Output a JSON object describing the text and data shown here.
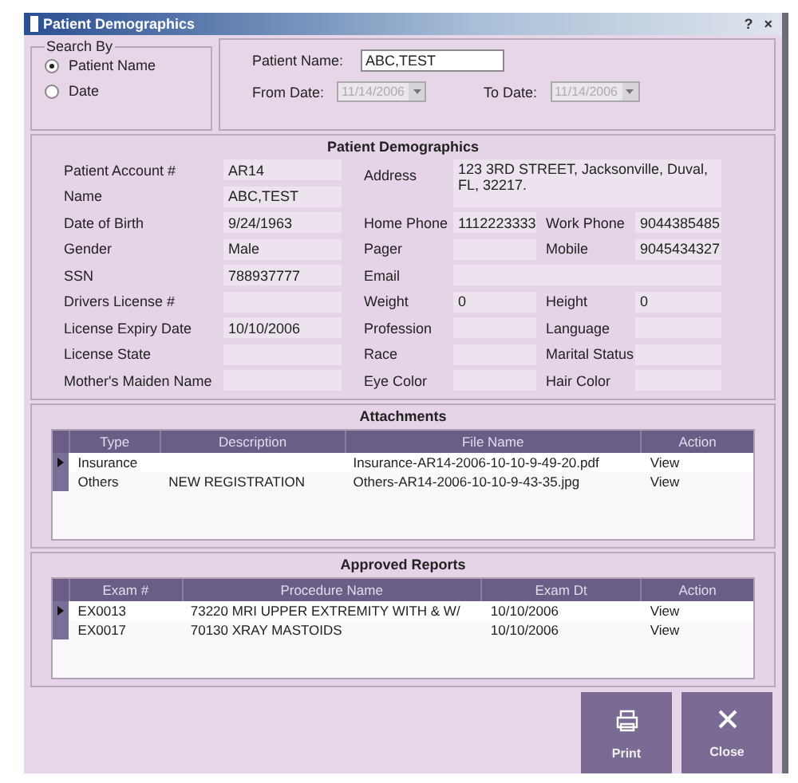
{
  "window": {
    "title": "Patient Demographics",
    "help_button": "?",
    "close_button": "×"
  },
  "search": {
    "group_label": "Search By",
    "options": [
      {
        "label": "Patient Name",
        "selected": true
      },
      {
        "label": "Date",
        "selected": false
      }
    ],
    "patient_name": {
      "label": "Patient Name:",
      "value": "ABC,TEST"
    },
    "from_date": {
      "label": "From Date:",
      "value": "11/14/2006",
      "disabled": true
    },
    "to_date": {
      "label": "To Date:",
      "value": "11/14/2006",
      "disabled": true
    }
  },
  "demographics": {
    "title": "Patient Demographics",
    "left_fields": [
      {
        "label": "Patient Account #",
        "value": "AR14"
      },
      {
        "label": "Name",
        "value": "ABC,TEST"
      },
      {
        "label": "Date of Birth",
        "value": "9/24/1963"
      },
      {
        "label": "Gender",
        "value": "Male"
      },
      {
        "label": "SSN",
        "value": "788937777"
      },
      {
        "label": "Drivers License #"
      },
      {
        "label": "License Expiry Date",
        "value": "10/10/2006"
      },
      {
        "label": "License State"
      },
      {
        "label": "Mother's Maiden Name"
      }
    ],
    "right_rows": [
      {
        "kind": "tall",
        "fields": [
          {
            "label": "Address",
            "value": "123 3RD STREET, Jacksonville, Duval, FL, 32217."
          }
        ]
      },
      {
        "kind": "pair",
        "fields": [
          {
            "label": "Home Phone",
            "value": "1112223333"
          },
          {
            "label": "Work Phone",
            "value": "9044385485"
          }
        ]
      },
      {
        "kind": "pair",
        "fields": [
          {
            "label": "Pager"
          },
          {
            "label": "Mobile",
            "value": "9045434327"
          }
        ]
      },
      {
        "kind": "wide",
        "fields": [
          {
            "label": "Email"
          }
        ]
      },
      {
        "kind": "pair",
        "fields": [
          {
            "label": "Weight",
            "value": "0"
          },
          {
            "label": "Height",
            "value": "0"
          }
        ]
      },
      {
        "kind": "pair",
        "fields": [
          {
            "label": "Profession"
          },
          {
            "label": "Language"
          }
        ]
      },
      {
        "kind": "pair",
        "fields": [
          {
            "label": "Race"
          },
          {
            "label": "Marital Status"
          }
        ]
      },
      {
        "kind": "pair",
        "fields": [
          {
            "label": "Eye Color"
          },
          {
            "label": "Hair Color"
          }
        ]
      }
    ]
  },
  "attachments": {
    "title": "Attachments",
    "columns": [
      "Type",
      "Description",
      "File Name",
      "Action"
    ],
    "rows": [
      {
        "selected": true,
        "cells": [
          "Insurance",
          null,
          "Insurance-AR14-2006-10-10-9-49-20.pdf",
          "View"
        ]
      },
      {
        "selected": false,
        "cells": [
          "Others",
          "NEW REGISTRATION",
          "Others-AR14-2006-10-10-9-43-35.jpg",
          "View"
        ]
      }
    ]
  },
  "approved_reports": {
    "title": "Approved Reports",
    "columns": [
      "Exam #",
      "Procedure Name",
      "Exam Dt",
      "Action"
    ],
    "rows": [
      {
        "selected": true,
        "cells": [
          "EX0013",
          "73220 MRI UPPER EXTREMITY WITH & W/",
          "10/10/2006",
          "View"
        ]
      },
      {
        "selected": false,
        "cells": [
          "EX0017",
          "70130 XRAY MASTOIDS",
          "10/10/2006",
          "View"
        ]
      }
    ]
  },
  "buttons": [
    {
      "kind": "print",
      "label": "Print"
    },
    {
      "kind": "close",
      "label": "Close"
    }
  ]
}
